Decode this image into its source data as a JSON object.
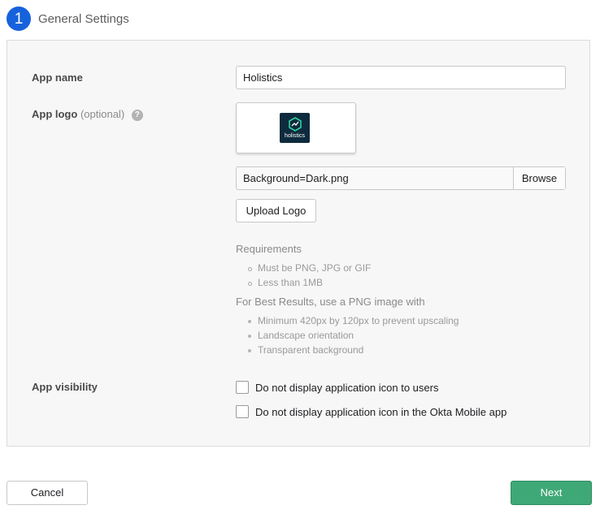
{
  "step": {
    "number": "1",
    "title": "General Settings"
  },
  "form": {
    "app_name": {
      "label": "App name",
      "value": "Holistics"
    },
    "app_logo": {
      "label": "App logo",
      "optional_text": "(optional)",
      "help_icon_text": "?",
      "logo_preview_text": "holistics",
      "file_name": "Background=Dark.png",
      "browse_label": "Browse",
      "upload_label": "Upload Logo"
    },
    "requirements": {
      "heading": "Requirements",
      "items": [
        "Must be PNG, JPG or GIF",
        "Less than 1MB"
      ]
    },
    "best_results": {
      "heading": "For Best Results, use a PNG image with",
      "items": [
        "Minimum 420px by 120px to prevent upscaling",
        "Landscape orientation",
        "Transparent background"
      ]
    },
    "app_visibility": {
      "label": "App visibility",
      "options": [
        {
          "label": "Do not display application icon to users",
          "checked": false
        },
        {
          "label": "Do not display application icon in the Okta Mobile app",
          "checked": false
        }
      ]
    }
  },
  "footer": {
    "cancel_label": "Cancel",
    "next_label": "Next"
  },
  "colors": {
    "primary": "#1662dd",
    "success": "#3fa877",
    "logo_bg": "#0e2b3d",
    "logo_accent": "#2fd1a2"
  }
}
